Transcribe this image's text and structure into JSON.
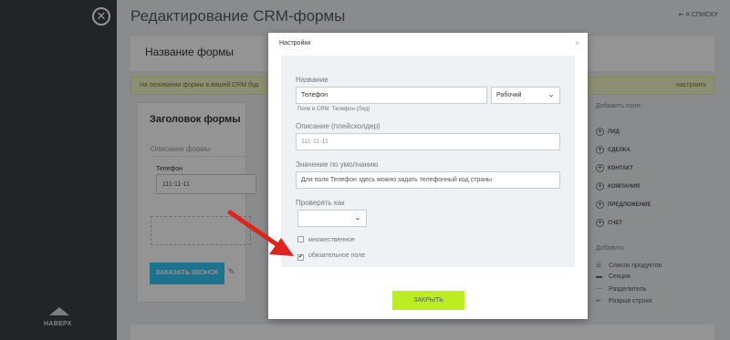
{
  "page": {
    "title": "Редактирование CRM-формы",
    "to_list": "К СПИСКУ",
    "up_label": "НАВЕРХ",
    "close_icon": "✕"
  },
  "form_header": {
    "name": "Название формы"
  },
  "info_bar": {
    "text": "На основании формы в вашей CRM буд",
    "setup": "настроить"
  },
  "form_card": {
    "title": "Заголовок формы",
    "description": "Описание формы",
    "phone_label": "Телефон",
    "phone_value": "111-11-11",
    "call_button": "ЗАКАЗАТЬ ЗВОНОК"
  },
  "right_panel": {
    "add_field": "Добавить поле:",
    "entities": [
      "ЛИД",
      "СДЕЛКА",
      "КОНТАКТ",
      "КОМПАНИЯ",
      "ПРЕДЛОЖЕНИЕ",
      "СЧЕТ"
    ],
    "add": "Добавить",
    "elements": [
      {
        "icon": "list-icon",
        "label": "Список продуктов"
      },
      {
        "icon": "section-icon",
        "label": "Секция"
      },
      {
        "icon": "divider-icon",
        "label": "Разделитель"
      },
      {
        "icon": "line-break-icon",
        "label": "Разрыв строки"
      }
    ]
  },
  "modal": {
    "title": "Настройки",
    "close": "×",
    "name_label": "Название",
    "name_value": "Телефон",
    "type_value": "Рабочий",
    "crm_hint": "Поле в CRM: Телефон (Лид)",
    "desc_label": "Описание (плейсхолдер)",
    "desc_value": "111-11-11",
    "default_label": "Значение по умолчанию",
    "default_value": "Для поля Телефон здесь можно задать телефонный код страны",
    "validate_label": "Проверять как",
    "validate_value": "",
    "multiple_label": "множественное",
    "multiple_checked": false,
    "required_label": "обязательное поле",
    "required_checked": true,
    "close_button": "ЗАКРЫТЬ"
  },
  "colors": {
    "accent_green": "#bbed21",
    "button_blue": "#2fc6f6",
    "annotation_red": "#e0241d"
  }
}
